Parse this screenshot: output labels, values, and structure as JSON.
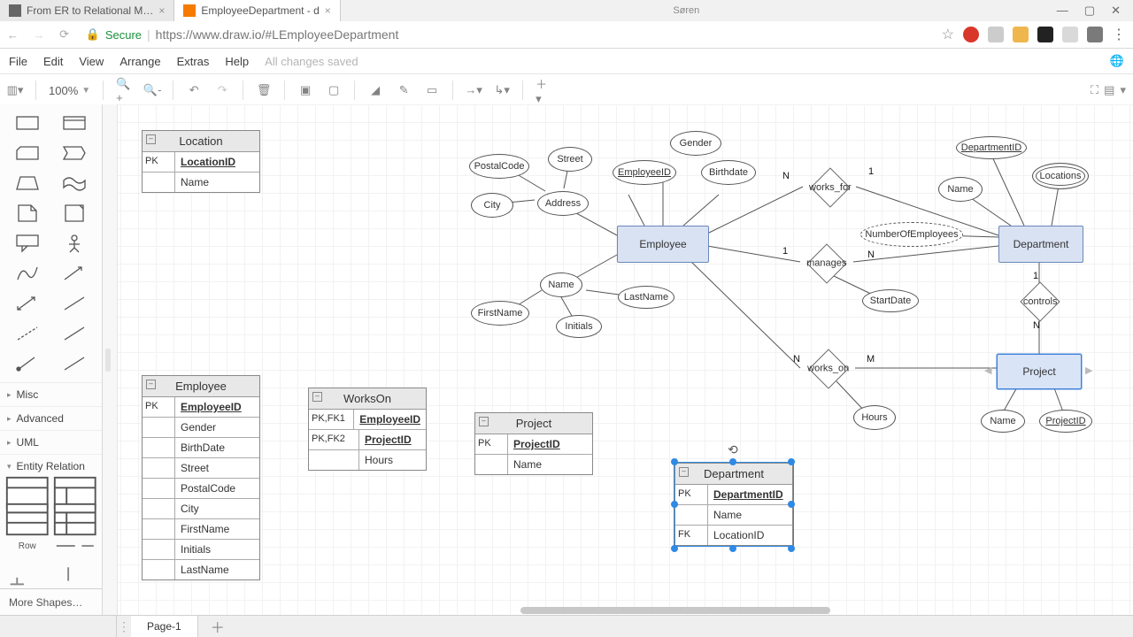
{
  "browser": {
    "tabs": [
      {
        "title": "From ER to Relational M…"
      },
      {
        "title": "EmployeeDepartment - d"
      }
    ],
    "user": "Søren",
    "secure": "Secure",
    "url": "https://www.draw.io/#LEmployeeDepartment",
    "star": "☆"
  },
  "menu": [
    "File",
    "Edit",
    "View",
    "Arrange",
    "Extras",
    "Help"
  ],
  "saved": "All changes saved",
  "zoom": "100%",
  "sidebar": {
    "sections": [
      "Misc",
      "Advanced",
      "UML",
      "Entity Relation"
    ],
    "row": "Row",
    "more": "More Shapes…"
  },
  "footer": {
    "page": "Page-1"
  },
  "er": {
    "employee": "Employee",
    "department": "Department",
    "project": "Project",
    "works_for": "works_for",
    "manages": "manages",
    "controls": "controls",
    "works_on": "works_on",
    "attrs": {
      "gender": "Gender",
      "birthdate": "Birthdate",
      "employeeid": "EmployeeID",
      "address": "Address",
      "city": "City",
      "postalcode": "PostalCode",
      "street": "Street",
      "name": "Name",
      "firstname": "FirstName",
      "lastname": "LastName",
      "initials": "Initials",
      "departmentid": "DepartmentID",
      "locations": "Locations",
      "numemp": "NumberOfEmployees",
      "startdate": "StartDate",
      "hours": "Hours",
      "projectid": "ProjectID"
    },
    "card": {
      "one": "1",
      "n": "N",
      "m": "M"
    }
  },
  "tables": {
    "location": {
      "title": "Location",
      "rows": [
        {
          "k": "PK",
          "v": "LocationID",
          "pk": true
        },
        {
          "k": "",
          "v": "Name"
        }
      ]
    },
    "employee": {
      "title": "Employee",
      "rows": [
        {
          "k": "PK",
          "v": "EmployeeID",
          "pk": true
        },
        {
          "k": "",
          "v": "Gender"
        },
        {
          "k": "",
          "v": "BirthDate"
        },
        {
          "k": "",
          "v": "Street"
        },
        {
          "k": "",
          "v": "PostalCode"
        },
        {
          "k": "",
          "v": "City"
        },
        {
          "k": "",
          "v": "FirstName"
        },
        {
          "k": "",
          "v": "Initials"
        },
        {
          "k": "",
          "v": "LastName"
        }
      ]
    },
    "workson": {
      "title": "WorksOn",
      "rows": [
        {
          "k": "PK,FK1",
          "v": "EmployeeID",
          "pk": true
        },
        {
          "k": "PK,FK2",
          "v": "ProjectID",
          "pk": true
        },
        {
          "k": "",
          "v": "Hours"
        }
      ]
    },
    "project": {
      "title": "Project",
      "rows": [
        {
          "k": "PK",
          "v": "ProjectID",
          "pk": true
        },
        {
          "k": "",
          "v": "Name"
        }
      ]
    },
    "department": {
      "title": "Department",
      "rows": [
        {
          "k": "PK",
          "v": "DepartmentID",
          "pk": true
        },
        {
          "k": "",
          "v": "Name"
        },
        {
          "k": "FK",
          "v": "LocationID"
        }
      ]
    }
  }
}
